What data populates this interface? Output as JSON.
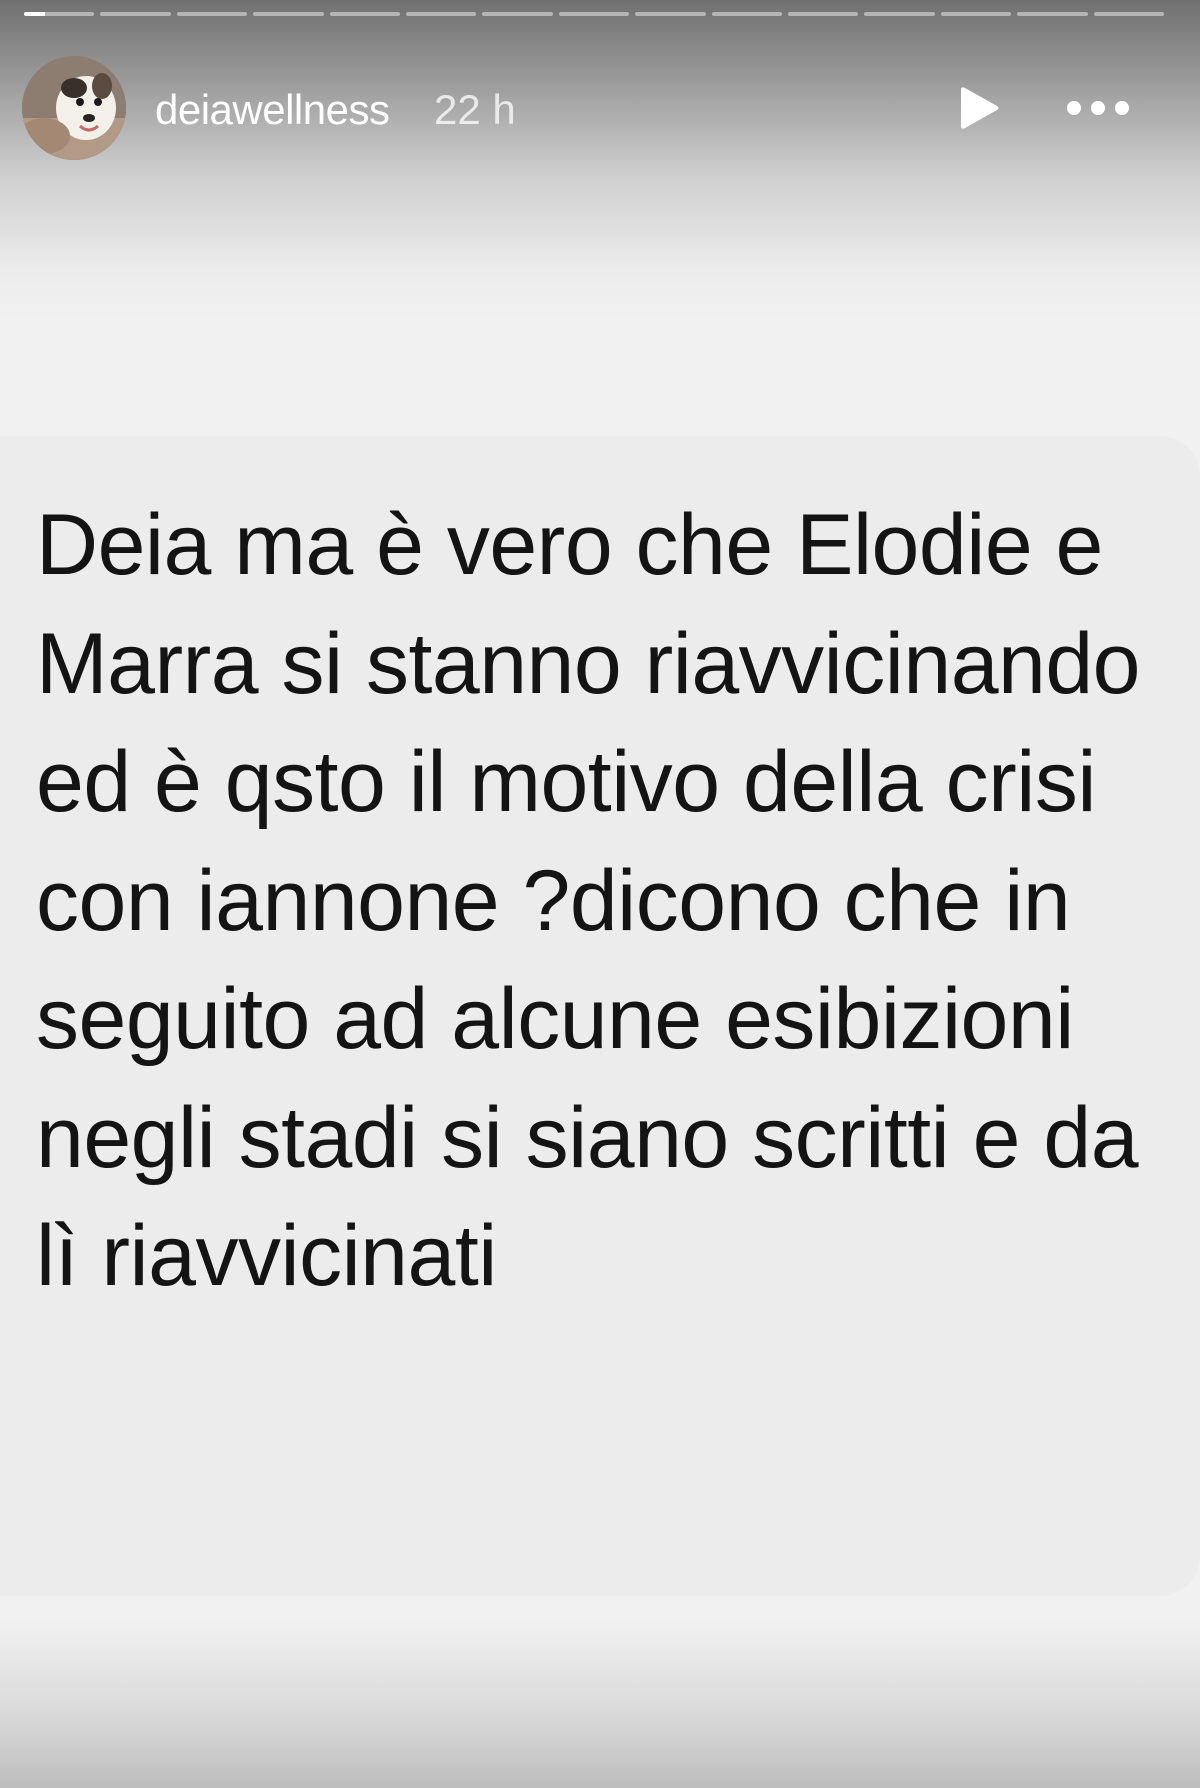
{
  "story": {
    "progress_segments": 15,
    "active_segment_progress": 0.3,
    "username": "deiawellness",
    "timestamp": "22 h",
    "play_icon": "play-icon",
    "more_icon": "more-options-icon"
  },
  "question": {
    "text": "Deia ma è vero che Elodie e Marra si stanno riavvicinando ed è qsto il motivo della crisi con iannone ?dicono che in seguito ad alcune esibizioni negli stadi si siano scritti e da lì riavvicinati"
  }
}
